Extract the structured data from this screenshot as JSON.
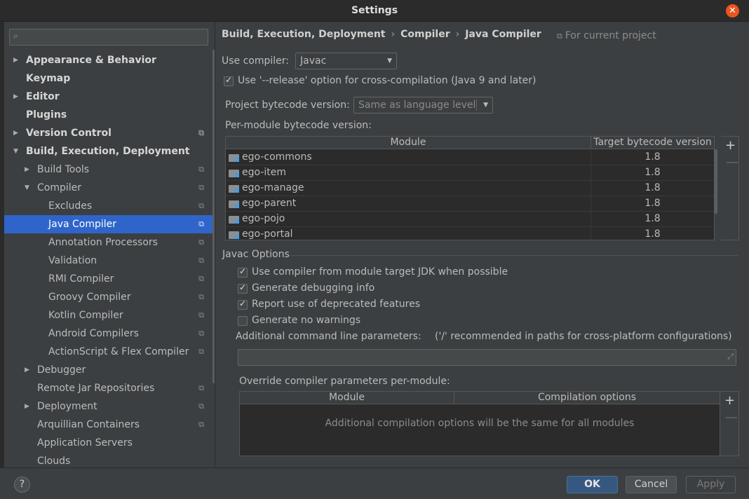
{
  "window": {
    "title": "Settings"
  },
  "search": {
    "placeholder": "",
    "value": ""
  },
  "sidebar": {
    "items": [
      {
        "label": "Appearance & Behavior",
        "indent": 0,
        "arrow": "right",
        "bold": true,
        "project": false
      },
      {
        "label": "Keymap",
        "indent": 0,
        "arrow": "",
        "bold": true,
        "project": false
      },
      {
        "label": "Editor",
        "indent": 0,
        "arrow": "right",
        "bold": true,
        "project": false
      },
      {
        "label": "Plugins",
        "indent": 0,
        "arrow": "",
        "bold": true,
        "project": false
      },
      {
        "label": "Version Control",
        "indent": 0,
        "arrow": "right",
        "bold": true,
        "project": true
      },
      {
        "label": "Build, Execution, Deployment",
        "indent": 0,
        "arrow": "down",
        "bold": true,
        "project": false
      },
      {
        "label": "Build Tools",
        "indent": 1,
        "arrow": "right",
        "bold": false,
        "project": true
      },
      {
        "label": "Compiler",
        "indent": 1,
        "arrow": "down",
        "bold": false,
        "project": true
      },
      {
        "label": "Excludes",
        "indent": 2,
        "arrow": "",
        "bold": false,
        "project": true
      },
      {
        "label": "Java Compiler",
        "indent": 2,
        "arrow": "",
        "bold": false,
        "project": true,
        "selected": true
      },
      {
        "label": "Annotation Processors",
        "indent": 2,
        "arrow": "",
        "bold": false,
        "project": true
      },
      {
        "label": "Validation",
        "indent": 2,
        "arrow": "",
        "bold": false,
        "project": true
      },
      {
        "label": "RMI Compiler",
        "indent": 2,
        "arrow": "",
        "bold": false,
        "project": true
      },
      {
        "label": "Groovy Compiler",
        "indent": 2,
        "arrow": "",
        "bold": false,
        "project": true
      },
      {
        "label": "Kotlin Compiler",
        "indent": 2,
        "arrow": "",
        "bold": false,
        "project": true
      },
      {
        "label": "Android Compilers",
        "indent": 2,
        "arrow": "",
        "bold": false,
        "project": true
      },
      {
        "label": "ActionScript & Flex Compiler",
        "indent": 2,
        "arrow": "",
        "bold": false,
        "project": true
      },
      {
        "label": "Debugger",
        "indent": 1,
        "arrow": "right",
        "bold": false,
        "project": false
      },
      {
        "label": "Remote Jar Repositories",
        "indent": 1,
        "arrow": "",
        "bold": false,
        "project": true
      },
      {
        "label": "Deployment",
        "indent": 1,
        "arrow": "right",
        "bold": false,
        "project": true
      },
      {
        "label": "Arquillian Containers",
        "indent": 1,
        "arrow": "",
        "bold": false,
        "project": true
      },
      {
        "label": "Application Servers",
        "indent": 1,
        "arrow": "",
        "bold": false,
        "project": false
      },
      {
        "label": "Clouds",
        "indent": 1,
        "arrow": "",
        "bold": false,
        "project": false
      }
    ]
  },
  "breadcrumb": {
    "part1": "Build, Execution, Deployment",
    "part2": "Compiler",
    "part3": "Java Compiler",
    "separator": "›"
  },
  "scope": {
    "label": "For current project"
  },
  "compiler": {
    "use_compiler_label": "Use compiler:",
    "use_compiler_value": "Javac",
    "release_option_label": "Use '--release' option for cross-compilation (Java 9 and later)",
    "release_option_checked": true,
    "bytecode_label": "Project bytecode version:",
    "bytecode_value": "Same as language level",
    "per_module_label": "Per-module bytecode version:"
  },
  "module_table": {
    "columns": [
      "Module",
      "Target bytecode version"
    ],
    "rows": [
      {
        "module": "ego-commons",
        "version": "1.8"
      },
      {
        "module": "ego-item",
        "version": "1.8"
      },
      {
        "module": "ego-manage",
        "version": "1.8"
      },
      {
        "module": "ego-parent",
        "version": "1.8"
      },
      {
        "module": "ego-pojo",
        "version": "1.8"
      },
      {
        "module": "ego-portal",
        "version": "1.8"
      }
    ]
  },
  "tools": {
    "add": "+",
    "remove": "—"
  },
  "javac": {
    "section_title": "Javac Options",
    "opt1": "Use compiler from module target JDK when possible",
    "opt2": "Generate debugging info",
    "opt3": "Report use of deprecated features",
    "opt4": "Generate no warnings",
    "checked": [
      true,
      true,
      true,
      false
    ],
    "cmdline_label": "Additional command line parameters:",
    "cmdline_hint": "('/' recommended in paths for cross-platform configurations)",
    "cmdline_value": "",
    "override_label": "Override compiler parameters per-module:",
    "override_columns": [
      "Module",
      "Compilation options"
    ],
    "override_empty": "Additional compilation options will be the same for all modules"
  },
  "buttons": {
    "help": "?",
    "ok": "OK",
    "cancel": "Cancel",
    "apply": "Apply"
  }
}
